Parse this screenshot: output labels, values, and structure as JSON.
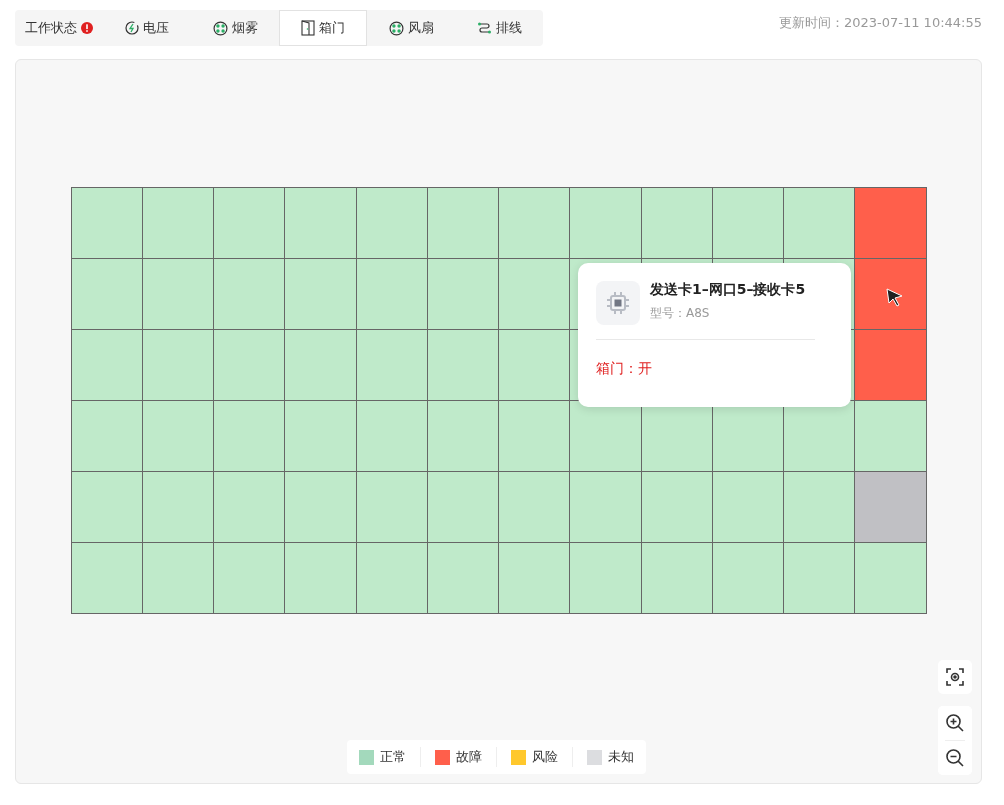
{
  "tabs": [
    {
      "label": "工作状态",
      "selected": false,
      "alert": true
    },
    {
      "label": "电压",
      "selected": false,
      "alert": false
    },
    {
      "label": "烟雾",
      "selected": false,
      "alert": false
    },
    {
      "label": "箱门",
      "selected": true,
      "alert": false
    },
    {
      "label": "风扇",
      "selected": false,
      "alert": false
    },
    {
      "label": "排线",
      "selected": false,
      "alert": false
    }
  ],
  "update_time": "更新时间：2023-07-11 10:44:55",
  "grid": {
    "rows": [
      {
        "cells": [
          {
            "color": "#bfeaca"
          },
          {
            "color": "#bfeaca"
          },
          {
            "color": "#bfeaca"
          },
          {
            "color": "#bfeaca"
          },
          {
            "color": "#bfeaca"
          },
          {
            "color": "#bfeaca"
          },
          {
            "color": "#bfeaca"
          },
          {
            "color": "#bfeaca"
          },
          {
            "color": "#bfeaca"
          },
          {
            "color": "#bfeaca"
          },
          {
            "color": "#bfeaca"
          },
          {
            "color": "#ff5f4b"
          }
        ]
      },
      {
        "cells": [
          {
            "color": "#bfeaca"
          },
          {
            "color": "#bfeaca"
          },
          {
            "color": "#bfeaca"
          },
          {
            "color": "#bfeaca"
          },
          {
            "color": "#bfeaca"
          },
          {
            "color": "#bfeaca"
          },
          {
            "color": "#bfeaca"
          },
          {
            "color": "#bfeaca"
          },
          {
            "color": "#bfeaca"
          },
          {
            "color": "#bfeaca"
          },
          {
            "color": "#bfeaca"
          },
          {
            "color": "#ff5f4b"
          }
        ]
      },
      {
        "cells": [
          {
            "color": "#bfeaca"
          },
          {
            "color": "#bfeaca"
          },
          {
            "color": "#bfeaca"
          },
          {
            "color": "#bfeaca"
          },
          {
            "color": "#bfeaca"
          },
          {
            "color": "#bfeaca"
          },
          {
            "color": "#bfeaca"
          },
          {
            "color": "#bfeaca"
          },
          {},
          {},
          {
            "color": "#bfeaca"
          },
          {
            "color": "#ff5f4b"
          }
        ]
      },
      {
        "cells": [
          {
            "color": "#bfeaca"
          },
          {
            "color": "#bfeaca"
          },
          {
            "color": "#bfeaca"
          },
          {
            "color": "#bfeaca"
          },
          {
            "color": "#bfeaca"
          },
          {
            "color": "#bfeaca"
          },
          {
            "color": "#bfeaca"
          },
          {
            "color": "#bfeaca"
          },
          {
            "color": "#bfeaca"
          },
          {
            "color": "#bfeaca"
          },
          {
            "color": "#bfeaca"
          },
          {
            "color": "#bfeaca"
          }
        ]
      },
      {
        "cells": [
          {
            "color": "#bfeaca"
          },
          {
            "color": "#bfeaca"
          },
          {
            "color": "#bfeaca"
          },
          {
            "color": "#bfeaca"
          },
          {
            "color": "#bfeaca"
          },
          {
            "color": "#bfeaca"
          },
          {
            "color": "#bfeaca"
          },
          {
            "color": "#bfeaca"
          },
          {
            "color": "#bfeaca"
          },
          {
            "color": "#bfeaca"
          },
          {
            "color": "#bfeaca"
          },
          {
            "color": "#c0c0c4"
          }
        ]
      },
      {
        "cells": [
          {
            "color": "#bfeaca"
          },
          {
            "color": "#bfeaca"
          },
          {
            "color": "#bfeaca"
          },
          {
            "color": "#bfeaca"
          },
          {
            "color": "#bfeaca"
          },
          {
            "color": "#bfeaca"
          },
          {
            "color": "#bfeaca"
          },
          {
            "color": "#bfeaca"
          },
          {
            "color": "#bfeaca"
          },
          {
            "color": "#bfeaca"
          },
          {
            "color": "#bfeaca"
          },
          {
            "color": "#bfeaca"
          }
        ]
      }
    ]
  },
  "tooltip": {
    "title": "发送卡1–网口5–接收卡5",
    "model": "型号：A8S",
    "status": "箱门：开"
  },
  "legend": [
    {
      "label": "正常",
      "color": "#a3d9bc"
    },
    {
      "label": "故障",
      "color": "#ff5f4b"
    },
    {
      "label": "风险",
      "color": "#ffc82c"
    },
    {
      "label": "未知",
      "color": "#dcdde0"
    }
  ]
}
